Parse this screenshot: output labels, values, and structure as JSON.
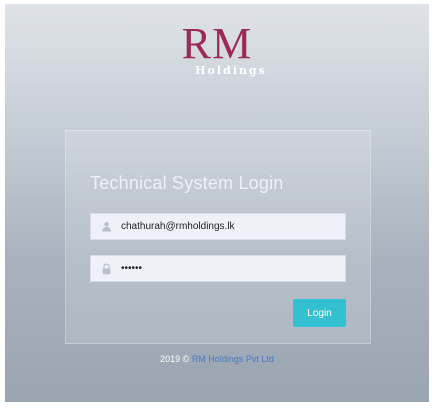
{
  "logo": {
    "brand": "RM",
    "subtitle": "Holdings"
  },
  "login": {
    "title": "Technical System Login",
    "username_value": "chathurah@rmholdings.lk",
    "password_value": "••••••",
    "login_label": "Login"
  },
  "footer": {
    "copyright": "2019 ©",
    "link_text": "RM Holdings Pvt Ltd"
  },
  "colors": {
    "brand": "#9b2a55",
    "button": "#33c1d2",
    "link": "#4a78c8"
  },
  "icons": {
    "username": "user-icon",
    "password": "lock-icon"
  }
}
